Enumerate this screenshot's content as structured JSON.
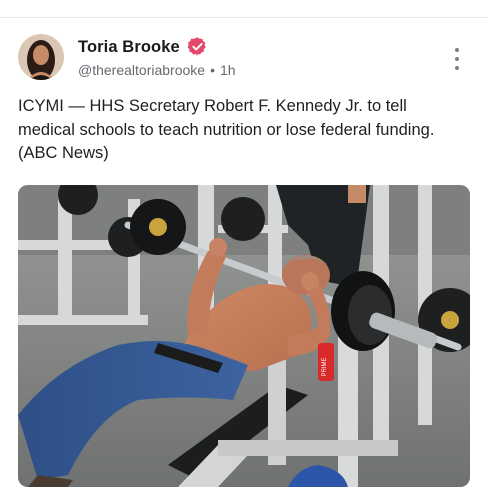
{
  "post": {
    "author": {
      "name": "Toria Brooke",
      "handle": "@therealtoriabrooke",
      "time": "1h",
      "verified": true,
      "avatar_icon": "profile-photo"
    },
    "text": "ICYMI — HHS Secretary Robert F. Kennedy Jr. to tell medical schools to teach nutrition or lose federal funding. (ABC News)",
    "menu_icon": "more-vertical-icon",
    "image": {
      "label": "PRIME"
    }
  },
  "colors": {
    "verified": "#e5486b",
    "handle": "#666a70",
    "divider": "#ececec"
  }
}
